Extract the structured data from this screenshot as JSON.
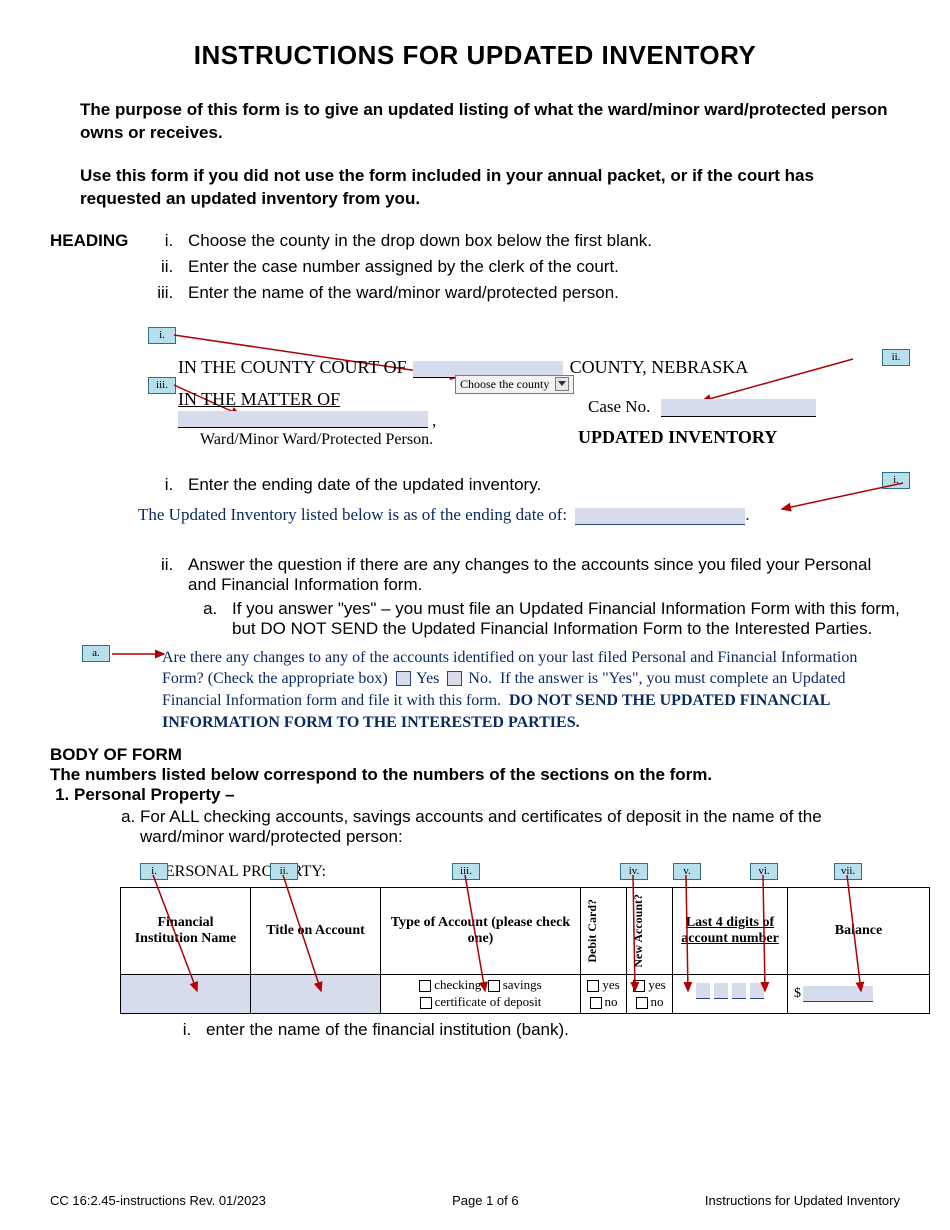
{
  "title": "INSTRUCTIONS FOR UPDATED INVENTORY",
  "intro": {
    "p1": "The purpose of this form is to give an updated listing of what the ward/minor ward/protected person owns or receives.",
    "p2": "Use this form if you did not use the form included in your annual packet, or if the court has requested an updated inventory from you."
  },
  "heading": {
    "label": "HEADING",
    "items": [
      "Choose the county in the drop down box below the first blank.",
      "Enter the case number assigned by the clerk of the court.",
      "Enter the name of the ward/minor ward/protected person."
    ]
  },
  "form_heading": {
    "county_line_prefix": "IN THE  COUNTY COURT OF",
    "county_line_suffix": "COUNTY, NEBRASKA",
    "dropdown_label": "Choose the county",
    "matter_line": "IN THE MATTER OF",
    "ward_caption": "Ward/Minor Ward/Protected Person.",
    "case_no_label": "Case No.",
    "updated_inventory": "UPDATED INVENTORY"
  },
  "callouts": {
    "i": "i.",
    "ii": "ii.",
    "iii": "iii.",
    "iv": "iv.",
    "v": "v.",
    "vi": "vi.",
    "vii": "vii.",
    "a": "a."
  },
  "mid": {
    "i_text": "Enter the ending date of the updated inventory.",
    "ending_line": "The Updated Inventory listed below is as of the ending date of:",
    "ii_text": "Answer the question if there are any changes to the accounts since you filed your Personal and Financial Information form.",
    "ii_a": "If you answer \"yes\" – you must file an Updated Financial Information Form with this form, but DO NOT SEND the Updated Financial Information Form to the Interested Parties."
  },
  "changes_block": {
    "part1": "Are there any changes to any of the accounts identified on your last filed Personal and Financial Information Form? (Check the appropriate box)",
    "yes": "Yes",
    "no": "No.",
    "part2": "If the answer is \"Yes\", you must complete an Updated Financial Information form and file it with this form.",
    "bold": "DO NOT SEND THE UPDATED FINANCIAL INFORMATION FORM TO THE INTERESTED PARTIES."
  },
  "body": {
    "hdr1": "BODY OF FORM",
    "hdr2": "The numbers listed below correspond to the numbers of the sections on the form.",
    "item1": "Personal Property –",
    "item1a": "For ALL checking accounts, savings accounts and certificates of deposit in the name of the ward/minor ward/protected person:",
    "pp_title": "1. PERSONAL PROPERTY:",
    "table": {
      "headers": {
        "fin": "Financial Institution Name",
        "title_on": "Title on Account",
        "type": "Type of Account (please check one)",
        "debit": "Debit Card?",
        "newacct": "New Account?",
        "last4": "Last 4 digits of account number",
        "balance": "Balance"
      },
      "type_opts": {
        "checking": "checking",
        "savings": "savings",
        "cod": "certificate of deposit"
      },
      "yn": {
        "yes": "yes",
        "no": "no"
      },
      "dollar": "$"
    },
    "item_i": "enter the name of the financial institution (bank)."
  },
  "footer": {
    "left": "CC 16:2.45-instructions Rev. 01/2023",
    "center": "Page 1 of 6",
    "right": "Instructions for Updated Inventory"
  }
}
